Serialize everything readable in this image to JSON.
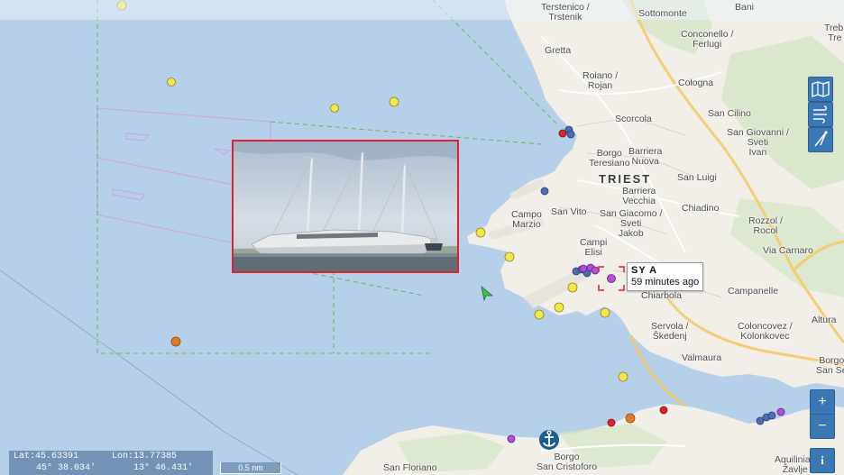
{
  "map": {
    "labels": {
      "terstenico": "Terstenico /\nTrstenik",
      "sottomonte": "Sottomonte",
      "bani": "Bani",
      "conconello": "Conconello /\nFerlugi",
      "trebiciano": "Trebi\nTre",
      "gretta": "Gretta",
      "roiano": "Roiano /\nRojan",
      "cologna": "Cologna",
      "scorcola": "Scorcola",
      "san_cilino": "San Cilino",
      "borgo_teresiano": "Borgo\nTeresiano",
      "barriera_nuova": "Barriera\nNuova",
      "san_giovanni": "San Giovanni /\nSveti\nIvan",
      "triest": "TRIEST",
      "barriera_vecchia": "Barriera\nVecchia",
      "san_luigi": "San Luigi",
      "campo_marzio": "Campo\nMarzio",
      "san_vito": "San Vito",
      "san_giacomo": "San Giacomo /\nSveti\nJakob",
      "chiadino": "Chiadino",
      "rozzol": "Rozzol /\nRocol",
      "campi_elisi": "Campi\nElisi",
      "via_carnaro": "Via Carnaro",
      "chiarbola": "Chiarbola",
      "campanelle": "Campanelle",
      "altura": "Altura",
      "servola": "Servola /\nŠkedenj",
      "coloncovez": "Coloncovez /\nKolonkovec",
      "valmaura": "Valmaura",
      "borgo_san_sergio": "Borgo\nSan Se",
      "san_floriano": "San Floriano",
      "borgo_san_cristoforo": "Borgo\nSan Cristoforo",
      "aquilinia": "Aquilinia /\nŽavlje"
    },
    "selected_vessel": {
      "name": "SY A",
      "last_seen": "59 minutes ago"
    },
    "colors": {
      "sea": "#b5d0e8",
      "land": "#f2efe9",
      "vessel_yellow": "#f2e84a",
      "vessel_orange": "#e07a2a",
      "vessel_red": "#d9262f",
      "vessel_blue": "#4a6fb5",
      "vessel_purple": "#b34fd6",
      "highlight": "#e0212b",
      "control_blue": "#3a78b5"
    }
  },
  "controls": {
    "map_layers_icon": "map-icon",
    "wind_layer_icon": "wind-icon",
    "measure_icon": "compass-icon",
    "zoom_in": "+",
    "zoom_out": "−",
    "info": "i"
  },
  "status": {
    "lat_label": "Lat:45.63391",
    "lon_label": "Lon:13.77385",
    "lat_dms": "45° 38.034'",
    "lon_dms": "13° 46.431'",
    "scale": "0.5 nm"
  }
}
